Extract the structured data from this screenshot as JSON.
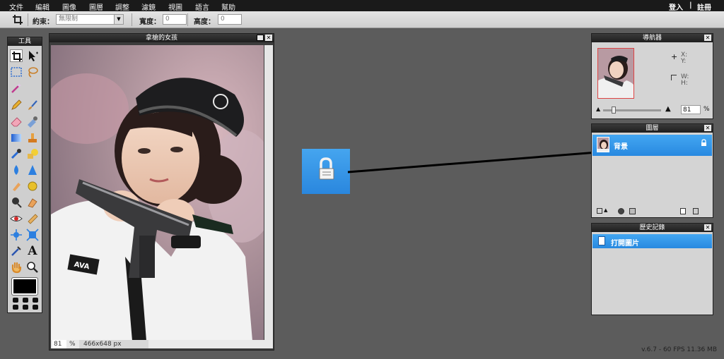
{
  "menu": {
    "items": [
      "文件",
      "編輯",
      "圖像",
      "圖層",
      "調整",
      "濾鏡",
      "視圖",
      "語言",
      "幫助"
    ],
    "login": "登入",
    "separator": "|",
    "register": "註冊"
  },
  "options": {
    "constraint_label": "約束：",
    "constraint_value": "無限制",
    "width_label": "寬度：",
    "width_value": "0",
    "height_label": "高度：",
    "height_value": "0"
  },
  "tools": {
    "title": "工具",
    "selected_tool": "crop"
  },
  "image_window": {
    "title": "拿槍的女孩",
    "zoom_value": "81",
    "zoom_unit": "%",
    "dimensions": "466x648 px"
  },
  "navigator": {
    "title": "導航器",
    "x_label": "X:",
    "y_label": "Y:",
    "w_label": "W:",
    "h_label": "H:",
    "zoom_value": "81",
    "zoom_unit": "%",
    "zoom_level": 0.4
  },
  "layers": {
    "title": "圖層",
    "items": [
      {
        "name": "背景",
        "locked": true
      }
    ]
  },
  "history": {
    "title": "歷史記錄",
    "items": [
      {
        "label": "打開圖片"
      }
    ]
  },
  "status": {
    "version": "v.6.7 - 60 FPS 11.36 MB"
  },
  "colors": {
    "accent": "#2c8ce2",
    "workspace": "#5c5c5c",
    "menubar": "#1a1a1a"
  }
}
